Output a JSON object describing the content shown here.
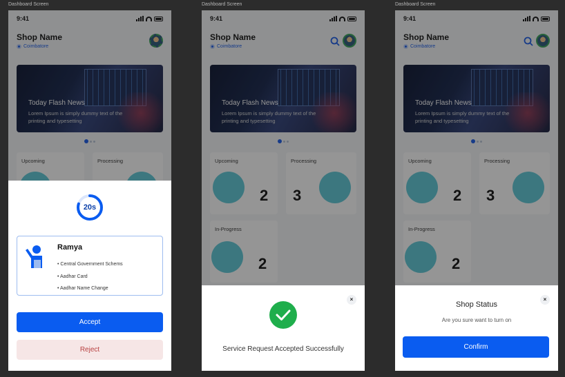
{
  "frame_label": "Dashboard Screen",
  "status": {
    "time": "9:41"
  },
  "header": {
    "shop_name": "Shop Name",
    "location": "Coimbatore"
  },
  "banner": {
    "title": "Today Flash News",
    "description": "Lorem Ipsum is simply dummy text of the printing and typesetting"
  },
  "cards": {
    "upcoming": {
      "label": "Upcoming",
      "count": "2"
    },
    "processing": {
      "label": "Processing",
      "count": "3"
    },
    "in_progress": {
      "label": "In-Progress",
      "count": "2"
    }
  },
  "request_modal": {
    "timer": "20s",
    "timer_fraction": 0.8,
    "customer_name": "Ramya",
    "services": [
      "Central Government Schems",
      "Aadhar Card",
      "Aadhar Name Change"
    ],
    "accept_label": "Accept",
    "reject_label": "Reject"
  },
  "success_modal": {
    "message": "Service Request Accepted Successfully",
    "close": "×"
  },
  "status_modal": {
    "title": "Shop Status",
    "subtitle": "Are you sure want to turn on",
    "confirm_label": "Confirm",
    "close": "×"
  },
  "colors": {
    "primary": "#0a5cf0",
    "success": "#1fae4c",
    "reject_bg": "#f6e6e6",
    "reject_text": "#b84040"
  },
  "icons": [
    "search-icon",
    "location-pin-icon",
    "check-icon",
    "close-icon",
    "person-icon",
    "signal-icon",
    "wifi-icon",
    "battery-icon"
  ]
}
